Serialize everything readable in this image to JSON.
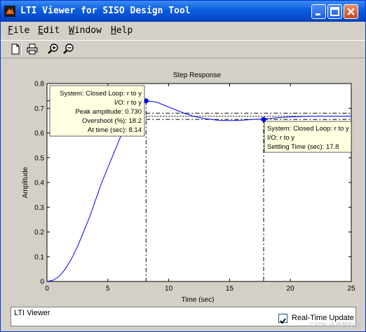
{
  "window": {
    "title": "LTI Viewer for SISO Design Tool"
  },
  "menu": [
    {
      "first": "F",
      "rest": "ile"
    },
    {
      "first": "E",
      "rest": "dit"
    },
    {
      "first": "W",
      "rest": "indow"
    },
    {
      "first": "H",
      "rest": "elp"
    }
  ],
  "toolbar": [
    "new-document-icon",
    "print-icon",
    "zoom-in-icon",
    "zoom-out-icon"
  ],
  "status": {
    "text": "LTI Viewer",
    "realtime_label": "Real-Time Update",
    "realtime_checked": true
  },
  "watermark": "CSDN @卓越科技",
  "datatips": {
    "peak": {
      "system": "System: Closed Loop: r to y",
      "io": "I/O: r to y",
      "peak_amplitude": "Peak amplitude: 0.730",
      "overshoot": "Overshoot (%): 18.2",
      "time": "At time (sec): 8.14"
    },
    "settling": {
      "system": "System: Closed Loop: r to y",
      "io": "I/O: r to y",
      "settling": "Settling Time (sec): 17.8"
    }
  },
  "colors": {
    "curve": "#0000ff",
    "title_bar": "#0a5ce0",
    "tip_bg": "#ffffe1"
  },
  "chart_data": {
    "type": "line",
    "title": "Step Response",
    "xlabel": "Time (sec)",
    "ylabel": "Amplitude",
    "xlim": [
      0,
      25
    ],
    "ylim": [
      0,
      0.8
    ],
    "xticks": [
      0,
      5,
      10,
      15,
      20,
      25
    ],
    "yticks": [
      0,
      0.1,
      0.2,
      0.3,
      0.4,
      0.5,
      0.6,
      0.7,
      0.8
    ],
    "series": [
      {
        "x": [
          0,
          0.5,
          1,
          1.5,
          2,
          2.5,
          3,
          3.5,
          4,
          4.5,
          5,
          5.5,
          6,
          6.5,
          7,
          7.5,
          8.14,
          9,
          10,
          11,
          12,
          13,
          14,
          15,
          16,
          17,
          17.8,
          19,
          20,
          21,
          22,
          23,
          24,
          25
        ],
        "y": [
          0,
          0.005,
          0.02,
          0.05,
          0.09,
          0.14,
          0.2,
          0.26,
          0.33,
          0.4,
          0.46,
          0.52,
          0.58,
          0.63,
          0.67,
          0.7,
          0.73,
          0.725,
          0.705,
          0.685,
          0.668,
          0.658,
          0.652,
          0.65,
          0.652,
          0.655,
          0.657,
          0.662,
          0.665,
          0.667,
          0.668,
          0.668,
          0.668,
          0.668
        ]
      }
    ],
    "peak": {
      "t": 8.14,
      "y": 0.73
    },
    "settling": {
      "t": 17.8,
      "y": 0.655
    },
    "final_value": 0.668,
    "settling_band": [
      0.68,
      0.655
    ]
  }
}
